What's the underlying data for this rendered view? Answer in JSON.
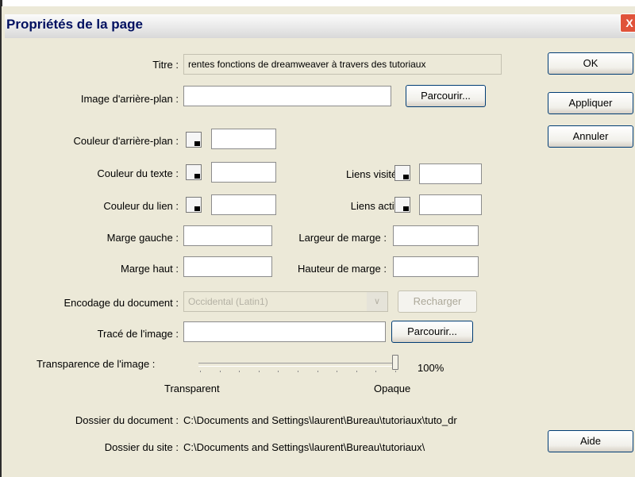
{
  "dialog": {
    "title": "Propriétés de la page",
    "close_glyph": "X"
  },
  "fields": {
    "titre_label": "Titre :",
    "titre_value": "rentes fonctions de dreamweaver à travers des tutoriaux",
    "image_fond_label": "Image d'arrière-plan :",
    "image_fond_value": "",
    "couleur_fond_label": "Couleur d'arrière-plan :",
    "couleur_texte_label": "Couleur du texte :",
    "couleur_lien_label": "Couleur du lien :",
    "liens_visites_label": "Liens visités :",
    "liens_actifs_label": "Liens actifs :",
    "marge_gauche_label": "Marge gauche :",
    "largeur_marge_label": "Largeur de marge :",
    "marge_haut_label": "Marge haut :",
    "hauteur_marge_label": "Hauteur de marge :",
    "encodage_label": "Encodage du document :",
    "encodage_value": "Occidental (Latin1)",
    "trace_label": "Tracé de l'image :",
    "trace_value": "",
    "transparence_label": "Transparence de l'image :",
    "transparence_value": "100%",
    "transparent_label": "Transparent",
    "opaque_label": "Opaque",
    "dossier_document_label": "Dossier du document :",
    "dossier_document_value": "C:\\Documents and Settings\\laurent\\Bureau\\tutoriaux\\tuto_dr",
    "dossier_site_label": "Dossier du site :",
    "dossier_site_value": "C:\\Documents and Settings\\laurent\\Bureau\\tutoriaux\\"
  },
  "buttons": {
    "parcourir": "Parcourir...",
    "recharger": "Recharger",
    "ok": "OK",
    "appliquer": "Appliquer",
    "annuler": "Annuler",
    "aide": "Aide"
  },
  "slider": {
    "transparency_fraction": 1.0
  },
  "colors": {
    "dialog_bg": "#ece9d8",
    "title_text": "#001060",
    "close_button": "#e0533a",
    "button_border": "#003c74"
  },
  "icons": {
    "swatch": "color-picker-icon",
    "dropdown": "chevron-down-icon",
    "close": "close-icon"
  }
}
